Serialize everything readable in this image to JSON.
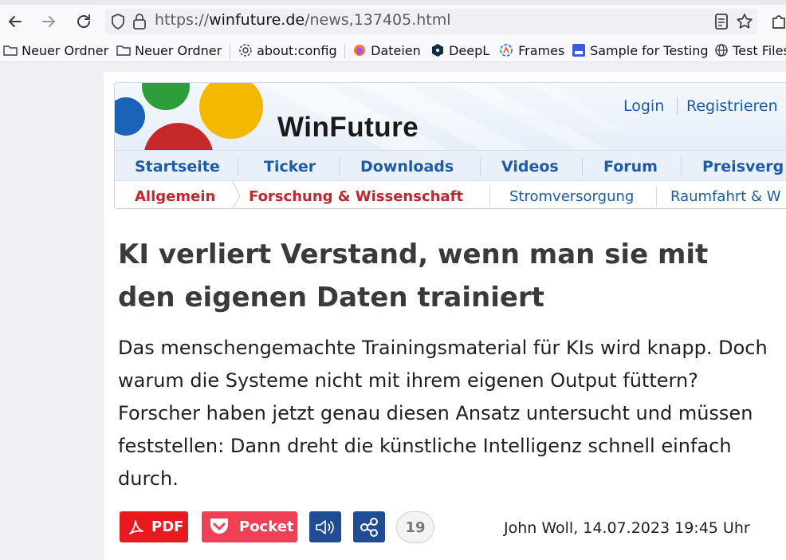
{
  "browser": {
    "url_prefix": "https://",
    "url_host": "winfuture.de",
    "url_path": "/news,137405.html",
    "bookmarks": [
      {
        "label": "Neuer Ordner",
        "icon": "folder-icon"
      },
      {
        "label": "Neuer Ordner",
        "icon": "folder-icon"
      },
      {
        "label": "about:config",
        "icon": "gear-icon"
      },
      {
        "label": "Dateien",
        "icon": "firefox-icon"
      },
      {
        "label": "DeepL",
        "icon": "deepl-icon"
      },
      {
        "label": "Frames",
        "icon": "frames-icon"
      },
      {
        "label": "Sample for Testing",
        "icon": "sample-icon"
      },
      {
        "label": "Test Files",
        "icon": "globe-icon"
      }
    ]
  },
  "site": {
    "logo": "WinFuture",
    "login": "Login",
    "register": "Registrieren",
    "colors": {
      "blue": "#1d5aa8",
      "red": "#c0282d"
    }
  },
  "main_nav": [
    "Startseite",
    "Ticker",
    "Downloads",
    "Videos",
    "Forum",
    "Preisverg"
  ],
  "sub_nav": {
    "breadcrumb_home": "Allgemein",
    "breadcrumb_current": "Forschung & Wissenschaft",
    "items": [
      "Stromversorgung",
      "Raumfahrt & W"
    ]
  },
  "article": {
    "headline": "KI verliert Verstand, wenn man sie mit den eigenen Daten trainiert",
    "lead": "Das menschengemachte Trainingsmaterial für KIs wird knapp. Doch warum die Systeme nicht mit ihrem eigenen Output füttern? Forscher haben jetzt genau diesen Ansatz untersucht und müssen feststellen: Dann dreht die künstliche Intelligenz schnell einfach durch.",
    "pdf_label": "PDF",
    "pocket_label": "Pocket",
    "comment_count": "19",
    "byline": "John Woll, 14.07.2023 19:45 Uhr"
  }
}
